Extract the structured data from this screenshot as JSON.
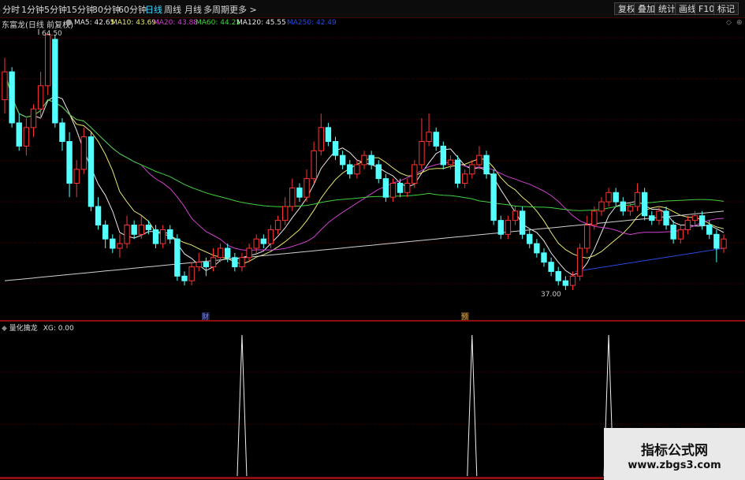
{
  "toolbar": {
    "periods": [
      "分时",
      "1分钟",
      "5分钟",
      "15分钟",
      "30分钟",
      "60分钟",
      "日线",
      "周线",
      "月线",
      "多周期",
      "更多"
    ],
    "active_period": "日线",
    "right_buttons": [
      "复权",
      "叠加",
      "统计",
      "画线",
      "F10",
      "标记"
    ],
    "more_arrow": ">"
  },
  "legend": {
    "stock_title": "东富龙(日线 前复权)",
    "ma": [
      {
        "label": "MA5: 42.65",
        "color": "#e8e8e8"
      },
      {
        "label": "MA10: 43.69",
        "color": "#e8e870"
      },
      {
        "label": "MA20: 43.88",
        "color": "#d040d0"
      },
      {
        "label": "MA60: 44.21",
        "color": "#40d040"
      },
      {
        "label": "MA120: 45.55",
        "color": "#e8e8e8"
      },
      {
        "label": "MA250: 42.49",
        "color": "#2a4ae0"
      }
    ]
  },
  "annotations": {
    "high": "64.50",
    "low": "37.00",
    "event1": "财",
    "event2": "预"
  },
  "indicator": {
    "title": "量化擒龙",
    "value_label": "XG: 0.00"
  },
  "watermark": {
    "line1": "指标公式网",
    "line2": "www.zbgs3.com"
  },
  "colors": {
    "up": "#ff3333",
    "down": "#54ffff",
    "grid": "#5a0000",
    "separator": "#8c0e0e"
  },
  "chart_data": {
    "type": "candlestick",
    "price_range": [
      37.0,
      64.5
    ],
    "candles": [
      [
        57.5,
        60.5,
        56.0,
        62.0
      ],
      [
        60.5,
        55.0,
        54.5,
        61.0
      ],
      [
        55.0,
        52.5,
        52.0,
        56.0
      ],
      [
        52.5,
        54.5,
        51.5,
        55.5
      ],
      [
        54.5,
        56.5,
        53.5,
        57.0
      ],
      [
        56.5,
        59.0,
        55.5,
        60.5
      ],
      [
        59.0,
        64.5,
        58.0,
        64.5
      ],
      [
        64.0,
        55.0,
        54.5,
        64.5
      ],
      [
        55.0,
        53.0,
        52.0,
        55.5
      ],
      [
        53.0,
        48.5,
        47.0,
        54.0
      ],
      [
        48.5,
        50.0,
        47.0,
        51.0
      ],
      [
        50.0,
        53.5,
        49.5,
        54.5
      ],
      [
        53.5,
        46.0,
        45.5,
        54.0
      ],
      [
        46.0,
        44.0,
        43.5,
        47.0
      ],
      [
        44.0,
        42.5,
        41.5,
        44.5
      ],
      [
        42.5,
        41.5,
        41.0,
        43.0
      ],
      [
        41.5,
        42.0,
        40.5,
        43.0
      ],
      [
        42.0,
        44.0,
        41.5,
        45.0
      ],
      [
        44.0,
        43.0,
        42.5,
        44.5
      ],
      [
        43.0,
        44.0,
        42.5,
        45.0
      ],
      [
        44.0,
        43.5,
        43.0,
        44.5
      ],
      [
        43.5,
        42.0,
        41.5,
        44.0
      ],
      [
        42.0,
        43.5,
        41.5,
        44.0
      ],
      [
        43.5,
        42.5,
        42.0,
        44.0
      ],
      [
        42.5,
        38.5,
        38.0,
        43.0
      ],
      [
        38.5,
        38.0,
        37.5,
        39.0
      ],
      [
        38.0,
        39.5,
        37.5,
        40.0
      ],
      [
        39.5,
        40.0,
        39.0,
        41.0
      ],
      [
        40.0,
        39.5,
        38.5,
        40.5
      ],
      [
        39.5,
        40.5,
        39.0,
        41.5
      ],
      [
        40.5,
        41.5,
        40.0,
        42.0
      ],
      [
        41.5,
        40.5,
        40.0,
        42.0
      ],
      [
        40.5,
        39.5,
        39.0,
        41.0
      ],
      [
        39.5,
        40.5,
        39.0,
        41.0
      ],
      [
        40.5,
        41.5,
        40.0,
        42.0
      ],
      [
        41.5,
        42.5,
        41.0,
        43.0
      ],
      [
        42.5,
        42.0,
        41.5,
        43.0
      ],
      [
        42.0,
        43.5,
        41.5,
        44.0
      ],
      [
        43.5,
        44.5,
        43.0,
        45.0
      ],
      [
        44.5,
        46.0,
        44.0,
        47.0
      ],
      [
        46.0,
        48.0,
        45.5,
        49.0
      ],
      [
        48.0,
        47.0,
        46.5,
        48.5
      ],
      [
        47.0,
        49.0,
        46.5,
        50.0
      ],
      [
        49.0,
        52.0,
        48.5,
        53.0
      ],
      [
        52.0,
        54.5,
        51.5,
        56.0
      ],
      [
        54.5,
        53.0,
        52.5,
        55.0
      ],
      [
        53.0,
        51.5,
        51.0,
        53.5
      ],
      [
        51.5,
        50.5,
        50.0,
        52.0
      ],
      [
        50.5,
        49.5,
        49.0,
        51.0
      ],
      [
        49.5,
        50.5,
        49.0,
        51.0
      ],
      [
        50.5,
        51.5,
        50.0,
        52.0
      ],
      [
        51.5,
        50.5,
        50.0,
        52.0
      ],
      [
        50.5,
        49.0,
        48.5,
        51.0
      ],
      [
        49.0,
        47.0,
        46.5,
        49.5
      ],
      [
        47.0,
        48.5,
        46.5,
        49.0
      ],
      [
        48.5,
        47.5,
        47.0,
        49.0
      ],
      [
        47.5,
        48.5,
        47.0,
        49.0
      ],
      [
        48.5,
        50.5,
        48.0,
        51.0
      ],
      [
        50.5,
        53.0,
        50.0,
        55.5
      ],
      [
        53.0,
        54.0,
        52.5,
        56.0
      ],
      [
        54.0,
        52.5,
        52.0,
        54.5
      ],
      [
        52.5,
        50.5,
        50.0,
        53.0
      ],
      [
        50.5,
        51.0,
        50.0,
        51.5
      ],
      [
        51.0,
        48.5,
        48.0,
        51.5
      ],
      [
        48.5,
        49.5,
        48.0,
        50.0
      ],
      [
        49.5,
        50.5,
        49.0,
        51.0
      ],
      [
        50.5,
        51.5,
        50.0,
        52.5
      ],
      [
        51.5,
        49.5,
        49.0,
        52.0
      ],
      [
        49.5,
        44.5,
        44.0,
        50.0
      ],
      [
        44.5,
        43.0,
        42.5,
        45.0
      ],
      [
        43.0,
        44.5,
        42.5,
        45.0
      ],
      [
        44.5,
        45.5,
        44.0,
        46.0
      ],
      [
        45.5,
        43.0,
        42.5,
        46.0
      ],
      [
        43.0,
        42.0,
        41.5,
        43.5
      ],
      [
        42.0,
        41.0,
        40.5,
        42.5
      ],
      [
        41.0,
        40.0,
        39.5,
        41.5
      ],
      [
        40.0,
        39.0,
        38.5,
        40.5
      ],
      [
        39.0,
        38.0,
        37.5,
        39.5
      ],
      [
        38.0,
        37.5,
        37.0,
        38.5
      ],
      [
        37.5,
        38.5,
        37.0,
        39.0
      ],
      [
        38.5,
        41.5,
        38.0,
        42.0
      ],
      [
        41.5,
        44.0,
        41.0,
        45.0
      ],
      [
        44.0,
        45.5,
        43.5,
        46.0
      ],
      [
        45.5,
        46.5,
        45.0,
        47.0
      ],
      [
        46.5,
        47.5,
        46.0,
        48.0
      ],
      [
        47.5,
        46.5,
        46.0,
        48.0
      ],
      [
        46.5,
        45.5,
        45.0,
        47.0
      ],
      [
        45.5,
        46.0,
        45.0,
        46.5
      ],
      [
        46.0,
        47.5,
        45.5,
        48.5
      ],
      [
        47.5,
        45.0,
        44.5,
        48.0
      ],
      [
        45.0,
        44.5,
        44.0,
        45.5
      ],
      [
        44.5,
        45.5,
        44.0,
        46.0
      ],
      [
        45.5,
        44.0,
        43.5,
        46.0
      ],
      [
        44.0,
        42.5,
        42.0,
        44.5
      ],
      [
        42.5,
        43.5,
        42.0,
        44.0
      ],
      [
        43.5,
        44.5,
        43.0,
        45.0
      ],
      [
        44.5,
        45.0,
        44.0,
        45.5
      ],
      [
        45.0,
        44.0,
        43.5,
        45.5
      ],
      [
        44.0,
        43.0,
        42.5,
        44.5
      ],
      [
        43.0,
        41.5,
        40.0,
        43.5
      ],
      [
        41.5,
        42.5,
        41.0,
        43.0
      ]
    ],
    "ma_series": [
      {
        "name": "MA5",
        "color": "#e8e8e8"
      },
      {
        "name": "MA10",
        "color": "#e8e870"
      },
      {
        "name": "MA20",
        "color": "#d040d0"
      },
      {
        "name": "MA60",
        "color": "#40d040"
      },
      {
        "name": "MA120",
        "color": "#d0d0d0"
      },
      {
        "name": "MA250",
        "color": "#2a4ae0"
      }
    ],
    "signals": [
      {
        "candle": 33,
        "value": 1
      },
      {
        "candle": 65,
        "value": 1
      },
      {
        "candle": 84,
        "value": 1
      }
    ],
    "grid": true
  }
}
